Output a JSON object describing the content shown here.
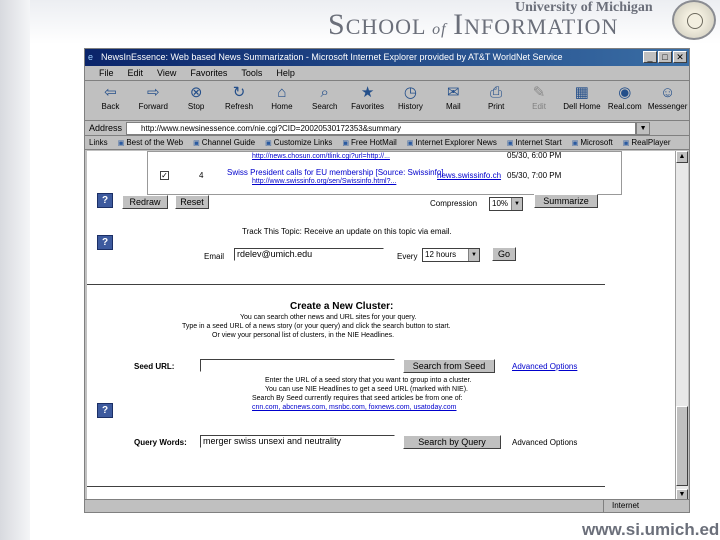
{
  "slide": {
    "header_university": "University of Michigan",
    "header_school_s": "S",
    "header_school_rest": "CHOOL",
    "header_of": "of",
    "header_info_i": "I",
    "header_info_rest": "NFORMATION",
    "footer_url": "www.si.umich.edu"
  },
  "browser": {
    "title": "NewsInEssence: Web based News Summarization - Microsoft Internet Explorer provided by AT&T WorldNet Service",
    "menu": [
      "File",
      "Edit",
      "View",
      "Favorites",
      "Tools",
      "Help"
    ],
    "toolbar": [
      {
        "label": "Back",
        "icon": "back-arrow-icon",
        "glyph": "⇦"
      },
      {
        "label": "Forward",
        "icon": "forward-arrow-icon",
        "glyph": "⇨"
      },
      {
        "label": "Stop",
        "icon": "stop-icon",
        "glyph": "⊗"
      },
      {
        "label": "Refresh",
        "icon": "refresh-icon",
        "glyph": "↻"
      },
      {
        "label": "Home",
        "icon": "home-icon",
        "glyph": "⌂"
      },
      {
        "label": "Search",
        "icon": "search-icon",
        "glyph": "⌕"
      },
      {
        "label": "Favorites",
        "icon": "favorites-icon",
        "glyph": "★"
      },
      {
        "label": "History",
        "icon": "history-icon",
        "glyph": "◷"
      },
      {
        "label": "Mail",
        "icon": "mail-icon",
        "glyph": "✉"
      },
      {
        "label": "Print",
        "icon": "print-icon",
        "glyph": "⎙"
      },
      {
        "label": "Edit",
        "icon": "edit-icon",
        "glyph": "✎"
      },
      {
        "label": "Dell Home",
        "icon": "dell-home-icon",
        "glyph": "▦"
      },
      {
        "label": "Real.com",
        "icon": "real-icon",
        "glyph": "◉"
      },
      {
        "label": "Messenger",
        "icon": "messenger-icon",
        "glyph": "☺"
      }
    ],
    "address_label": "Address",
    "address_value": "http://www.newsinessence.com/nie.cgi?CID=20020530172353&summary",
    "links_label": "Links",
    "links": [
      "Best of the Web",
      "Channel Guide",
      "Customize Links",
      "Free HotMail",
      "Internet Explorer News",
      "Internet Start",
      "Microsoft",
      "RealPlayer"
    ],
    "status_text": "",
    "status_zone": "Internet"
  },
  "page": {
    "rows": [
      {
        "url": "http://news.chosun.com/tlink.cgi?url=http://...",
        "title": "",
        "date": "05/30, 6:00 PM",
        "checked": true,
        "num": ""
      },
      {
        "url": "http://www.swissinfo.org/sen/Swissinfo.html?...",
        "title": "Swiss President calls for EU membership [Source: Swissinfo]",
        "date": "05/30, 7:00 PM",
        "checked": true,
        "num": "4",
        "source": "news.swissinfo.ch"
      }
    ],
    "redraw_label": "Redraw",
    "reset_label": "Reset",
    "compression_label": "Compression",
    "compression_value": "10%",
    "summarize_label": "Summarize",
    "track_heading": "Track This Topic:",
    "track_desc": "Receive an update on this topic via email.",
    "email_label": "Email",
    "email_value": "rdelev@umich.edu",
    "every_label": "Every",
    "every_value": "12 hours",
    "go_label": "Go",
    "cluster_heading": "Create a New Cluster:",
    "cluster_line1": "You can search other news and URL sites for your query.",
    "cluster_line2": "Type in a seed URL of a news story (or your query) and click the search button to start.",
    "cluster_line3": "Or view your personal list of clusters, in the NIE Headlines.",
    "cluster_link": "NIE Headlines",
    "seed_label": "Seed URL:",
    "seed_value": "",
    "search_seed_label": "Search from Seed",
    "advanced_label": "Advanced Options",
    "seed_help1": "Enter the URL of a seed story that you want to group into a cluster.",
    "seed_help2": "You can use NIE Headlines to get a seed URL (marked with NIE).",
    "seed_help3": "Search By Seed currently requires that seed articles be from one of:",
    "seed_help4": "cnn.com, abcnews.com, msnbc.com, foxnews.com, usatoday.com",
    "query_label": "Query Words:",
    "query_value": "merger swiss unsexi and neutrality",
    "search_query_label": "Search by Query",
    "advanced_label2": "Advanced Options"
  }
}
